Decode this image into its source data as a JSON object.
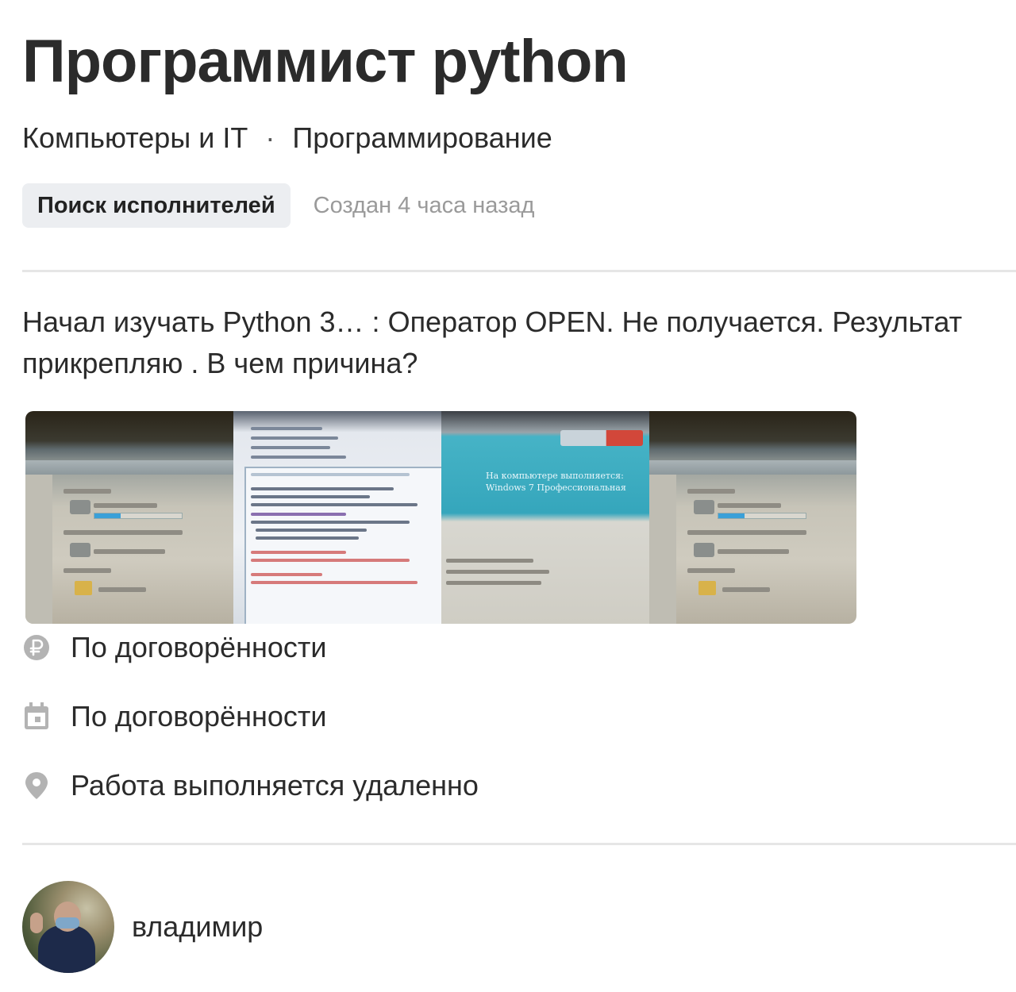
{
  "task": {
    "title": "Программист python",
    "breadcrumbs": [
      "Компьютеры и IT",
      "Программирование"
    ],
    "breadcrumb_separator": "·",
    "status": "Поиск исполнителей",
    "created": "Создан 4 часа назад",
    "description": "Начал изучать Python 3… : Оператор OPEN. Не получается. Результат прикрепляю . В чем причина?"
  },
  "gallery": {
    "photo_count": 4,
    "win7_caption": "На компьютере выполняется: Windows 7 Профессиональная"
  },
  "meta": {
    "price": {
      "icon": "ruble-icon",
      "text": "По договорённости"
    },
    "deadline": {
      "icon": "calendar-icon",
      "text": "По договорённости"
    },
    "location": {
      "icon": "map-pin-icon",
      "text": "Работа выполняется удаленно"
    }
  },
  "author": {
    "name": "владимир"
  },
  "colors": {
    "text": "#2b2b2b",
    "muted": "#9a9a9a",
    "badge_bg": "#eceef1",
    "divider": "#e6e6e6",
    "icon": "#b3b3b3"
  }
}
